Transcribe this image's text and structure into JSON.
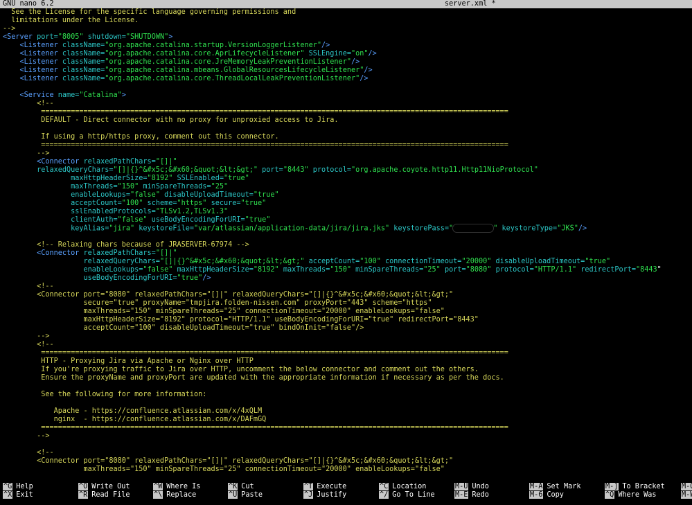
{
  "titlebar": {
    "app": "GNU nano 6.2",
    "file": "server.xml *"
  },
  "lines": [
    [
      {
        "c": "com",
        "t": "  See the License for the specific language governing permissions and"
      }
    ],
    [
      {
        "c": "com",
        "t": "  limitations under the License."
      }
    ],
    [
      {
        "c": "com",
        "t": "-->"
      }
    ],
    [
      {
        "c": "tag",
        "t": "<Server "
      },
      {
        "c": "attr",
        "t": "port="
      },
      {
        "c": "val",
        "t": "\"8005\""
      },
      {
        "c": "attr",
        "t": " shutdown="
      },
      {
        "c": "val",
        "t": "\"SHUTDOWN\""
      },
      {
        "c": "tag",
        "t": ">"
      }
    ],
    [
      {
        "c": "tag",
        "t": "    <Listener "
      },
      {
        "c": "attr",
        "t": "className="
      },
      {
        "c": "val",
        "t": "\"org.apache.catalina.startup.VersionLoggerListener\""
      },
      {
        "c": "tag",
        "t": "/>"
      }
    ],
    [
      {
        "c": "tag",
        "t": "    <Listener "
      },
      {
        "c": "attr",
        "t": "className="
      },
      {
        "c": "val",
        "t": "\"org.apache.catalina.core.AprLifecycleListener\""
      },
      {
        "c": "attr",
        "t": " SSLEngine="
      },
      {
        "c": "val",
        "t": "\"on\""
      },
      {
        "c": "tag",
        "t": "/>"
      }
    ],
    [
      {
        "c": "tag",
        "t": "    <Listener "
      },
      {
        "c": "attr",
        "t": "className="
      },
      {
        "c": "val",
        "t": "\"org.apache.catalina.core.JreMemoryLeakPreventionListener\""
      },
      {
        "c": "tag",
        "t": "/>"
      }
    ],
    [
      {
        "c": "tag",
        "t": "    <Listener "
      },
      {
        "c": "attr",
        "t": "className="
      },
      {
        "c": "val",
        "t": "\"org.apache.catalina.mbeans.GlobalResourcesLifecycleListener\""
      },
      {
        "c": "tag",
        "t": "/>"
      }
    ],
    [
      {
        "c": "tag",
        "t": "    <Listener "
      },
      {
        "c": "attr",
        "t": "className="
      },
      {
        "c": "val",
        "t": "\"org.apache.catalina.core.ThreadLocalLeakPreventionListener\""
      },
      {
        "c": "tag",
        "t": "/>"
      }
    ],
    [],
    [
      {
        "c": "tag",
        "t": "    <Service "
      },
      {
        "c": "attr",
        "t": "name="
      },
      {
        "c": "val",
        "t": "\"Catalina\""
      },
      {
        "c": "tag",
        "t": ">"
      }
    ],
    [
      {
        "c": "com",
        "t": "        <!--"
      }
    ],
    [
      {
        "c": "com",
        "t": "         =============================================================================================================="
      }
    ],
    [
      {
        "c": "com",
        "t": "         DEFAULT - Direct connector with no proxy for unproxied access to Jira."
      }
    ],
    [],
    [
      {
        "c": "com",
        "t": "         If using a http/https proxy, comment out this connector."
      }
    ],
    [
      {
        "c": "com",
        "t": "         =============================================================================================================="
      }
    ],
    [
      {
        "c": "com",
        "t": "        -->"
      }
    ],
    [
      {
        "c": "tag",
        "t": "        <Connector "
      },
      {
        "c": "attr",
        "t": "relaxedPathChars="
      },
      {
        "c": "val",
        "t": "\"[]|\""
      }
    ],
    [
      {
        "c": "attr",
        "t": "        relaxedQueryChars="
      },
      {
        "c": "val",
        "t": "\"[]|{}^&#x5c;&#x60;&quot;&lt;&gt;\""
      },
      {
        "c": "attr",
        "t": " port="
      },
      {
        "c": "val",
        "t": "\"8443\""
      },
      {
        "c": "attr",
        "t": " protocol="
      },
      {
        "c": "val",
        "t": "\"org.apache.coyote.http11.Http11NioProtocol\""
      }
    ],
    [
      {
        "c": "attr",
        "t": "                maxHttpHeaderSize="
      },
      {
        "c": "val",
        "t": "\"8192\""
      },
      {
        "c": "attr",
        "t": " SSLEnabled="
      },
      {
        "c": "val",
        "t": "\"true\""
      }
    ],
    [
      {
        "c": "attr",
        "t": "                maxThreads="
      },
      {
        "c": "val",
        "t": "\"150\""
      },
      {
        "c": "attr",
        "t": " minSpareThreads="
      },
      {
        "c": "val",
        "t": "\"25\""
      }
    ],
    [
      {
        "c": "attr",
        "t": "                enableLookups="
      },
      {
        "c": "val",
        "t": "\"false\""
      },
      {
        "c": "attr",
        "t": " disableUploadTimeout="
      },
      {
        "c": "val",
        "t": "\"true\""
      }
    ],
    [
      {
        "c": "attr",
        "t": "                acceptCount="
      },
      {
        "c": "val",
        "t": "\"100\""
      },
      {
        "c": "attr",
        "t": " scheme="
      },
      {
        "c": "val",
        "t": "\"https\""
      },
      {
        "c": "attr",
        "t": " secure="
      },
      {
        "c": "val",
        "t": "\"true\""
      }
    ],
    [
      {
        "c": "attr",
        "t": "                sslEnabledProtocols="
      },
      {
        "c": "val",
        "t": "\"TLSv1.2,TLSv1.3\""
      }
    ],
    [
      {
        "c": "attr",
        "t": "                clientAuth="
      },
      {
        "c": "val",
        "t": "\"false\""
      },
      {
        "c": "attr",
        "t": " useBodyEncodingForURI="
      },
      {
        "c": "val",
        "t": "\"true\""
      }
    ],
    [
      {
        "c": "attr",
        "t": "                keyAlias="
      },
      {
        "c": "val",
        "t": "\"jira\""
      },
      {
        "c": "attr",
        "t": " keystoreFile="
      },
      {
        "c": "val",
        "t": "\"var/atlassian/application-data/jira/jira.jks\""
      },
      {
        "c": "attr",
        "t": " keystorePass="
      },
      {
        "c": "val",
        "t": "\""
      },
      {
        "c": "redact",
        "t": ""
      },
      {
        "c": "val",
        "t": "\""
      },
      {
        "c": "attr",
        "t": " keystoreType="
      },
      {
        "c": "val",
        "t": "\"JKS\""
      },
      {
        "c": "tag",
        "t": "/>"
      }
    ],
    [],
    [
      {
        "c": "com",
        "t": "        <!-- Relaxing chars because of JRASERVER-67974 -->"
      }
    ],
    [
      {
        "c": "tag",
        "t": "        <Connector "
      },
      {
        "c": "attr",
        "t": "relaxedPathChars="
      },
      {
        "c": "val",
        "t": "\"[]|\""
      }
    ],
    [
      {
        "c": "attr",
        "t": "                   relaxedQueryChars="
      },
      {
        "c": "val",
        "t": "\"[]|{}^&#x5c;&#x60;&quot;&lt;&gt;\""
      },
      {
        "c": "attr",
        "t": " acceptCount="
      },
      {
        "c": "val",
        "t": "\"100\""
      },
      {
        "c": "attr",
        "t": " connectionTimeout="
      },
      {
        "c": "val",
        "t": "\"20000\""
      },
      {
        "c": "attr",
        "t": " disableUploadTimeout="
      },
      {
        "c": "val",
        "t": "\"true\""
      }
    ],
    [
      {
        "c": "attr",
        "t": "                   enableLookups="
      },
      {
        "c": "val",
        "t": "\"false\""
      },
      {
        "c": "attr",
        "t": " maxHttpHeaderSize="
      },
      {
        "c": "val",
        "t": "\"8192\""
      },
      {
        "c": "attr",
        "t": " maxThreads="
      },
      {
        "c": "val",
        "t": "\"150\""
      },
      {
        "c": "attr",
        "t": " minSpareThreads="
      },
      {
        "c": "val",
        "t": "\"25\""
      },
      {
        "c": "attr",
        "t": " port="
      },
      {
        "c": "val",
        "t": "\"8080\""
      },
      {
        "c": "attr",
        "t": " protocol="
      },
      {
        "c": "val",
        "t": "\"HTTP/1.1\""
      },
      {
        "c": "attr",
        "t": " redirectPort="
      },
      {
        "c": "val",
        "t": "\"8443"
      },
      {
        "c": "cursor",
        "t": "\""
      }
    ],
    [
      {
        "c": "attr",
        "t": "                   useBodyEncodingForURI="
      },
      {
        "c": "val",
        "t": "\"true\""
      },
      {
        "c": "tag",
        "t": "/>"
      }
    ],
    [
      {
        "c": "com",
        "t": "        <!--"
      }
    ],
    [
      {
        "c": "com",
        "t": "        <Connector port=\"8080\" relaxedPathChars=\"[]|\" relaxedQueryChars=\"[]|{}^&#x5c;&#x60;&quot;&lt;&gt;\""
      }
    ],
    [
      {
        "c": "com",
        "t": "                   secure=\"true\" proxyName=\"tmpjira.folden-nissen.com\" proxyPort=\"443\" scheme=\"https\""
      }
    ],
    [
      {
        "c": "com",
        "t": "                   maxThreads=\"150\" minSpareThreads=\"25\" connectionTimeout=\"20000\" enableLookups=\"false\""
      }
    ],
    [
      {
        "c": "com",
        "t": "                   maxHttpHeaderSize=\"8192\" protocol=\"HTTP/1.1\" useBodyEncodingForURI=\"true\" redirectPort=\"8443\""
      }
    ],
    [
      {
        "c": "com",
        "t": "                   acceptCount=\"100\" disableUploadTimeout=\"true\" bindOnInit=\"false\"/>"
      }
    ],
    [
      {
        "c": "com",
        "t": "        -->"
      }
    ],
    [
      {
        "c": "com",
        "t": "        <!--"
      }
    ],
    [
      {
        "c": "com",
        "t": "         =============================================================================================================="
      }
    ],
    [
      {
        "c": "com",
        "t": "         HTTP - Proxying Jira via Apache or Nginx over HTTP"
      }
    ],
    [
      {
        "c": "com",
        "t": "         If you're proxying traffic to Jira over HTTP, uncomment the below connector and comment out the others."
      }
    ],
    [
      {
        "c": "com",
        "t": "         Ensure the proxyName and proxyPort are updated with the appropriate information if necessary as per the docs."
      }
    ],
    [],
    [
      {
        "c": "com",
        "t": "         See the following for more information:"
      }
    ],
    [],
    [
      {
        "c": "com",
        "t": "            Apache - https://confluence.atlassian.com/x/4xQLM"
      }
    ],
    [
      {
        "c": "com",
        "t": "            nginx  - https://confluence.atlassian.com/x/DAFmGQ"
      }
    ],
    [
      {
        "c": "com",
        "t": "         =============================================================================================================="
      }
    ],
    [
      {
        "c": "com",
        "t": "        -->"
      }
    ],
    [],
    [
      {
        "c": "com",
        "t": "        <!--"
      }
    ],
    [
      {
        "c": "com",
        "t": "        <Connector port=\"8080\" relaxedPathChars=\"[]|\" relaxedQueryChars=\"[]|{}^&#x5c;&#x60;&quot;&lt;&gt;\""
      }
    ],
    [
      {
        "c": "com",
        "t": "                   maxThreads=\"150\" minSpareThreads=\"25\" connectionTimeout=\"20000\" enableLookups=\"false\""
      }
    ]
  ],
  "shortcuts": {
    "row1": [
      {
        "key": "^G",
        "label": "Help"
      },
      {
        "key": "^O",
        "label": "Write Out"
      },
      {
        "key": "^W",
        "label": "Where Is"
      },
      {
        "key": "^K",
        "label": "Cut"
      },
      {
        "key": "^T",
        "label": "Execute"
      },
      {
        "key": "^C",
        "label": "Location"
      },
      {
        "key": "M-U",
        "label": "Undo"
      },
      {
        "key": "M-A",
        "label": "Set Mark"
      },
      {
        "key": "M-]",
        "label": "To Bracket"
      },
      {
        "key": "M-Q",
        "label": ""
      }
    ],
    "row2": [
      {
        "key": "^X",
        "label": "Exit"
      },
      {
        "key": "^R",
        "label": "Read File"
      },
      {
        "key": "^\\",
        "label": "Replace"
      },
      {
        "key": "^U",
        "label": "Paste"
      },
      {
        "key": "^J",
        "label": "Justify"
      },
      {
        "key": "^/",
        "label": "Go To Line"
      },
      {
        "key": "M-E",
        "label": "Redo"
      },
      {
        "key": "M-6",
        "label": "Copy"
      },
      {
        "key": "^Q",
        "label": "Where Was"
      },
      {
        "key": "M-W",
        "label": ""
      }
    ]
  }
}
